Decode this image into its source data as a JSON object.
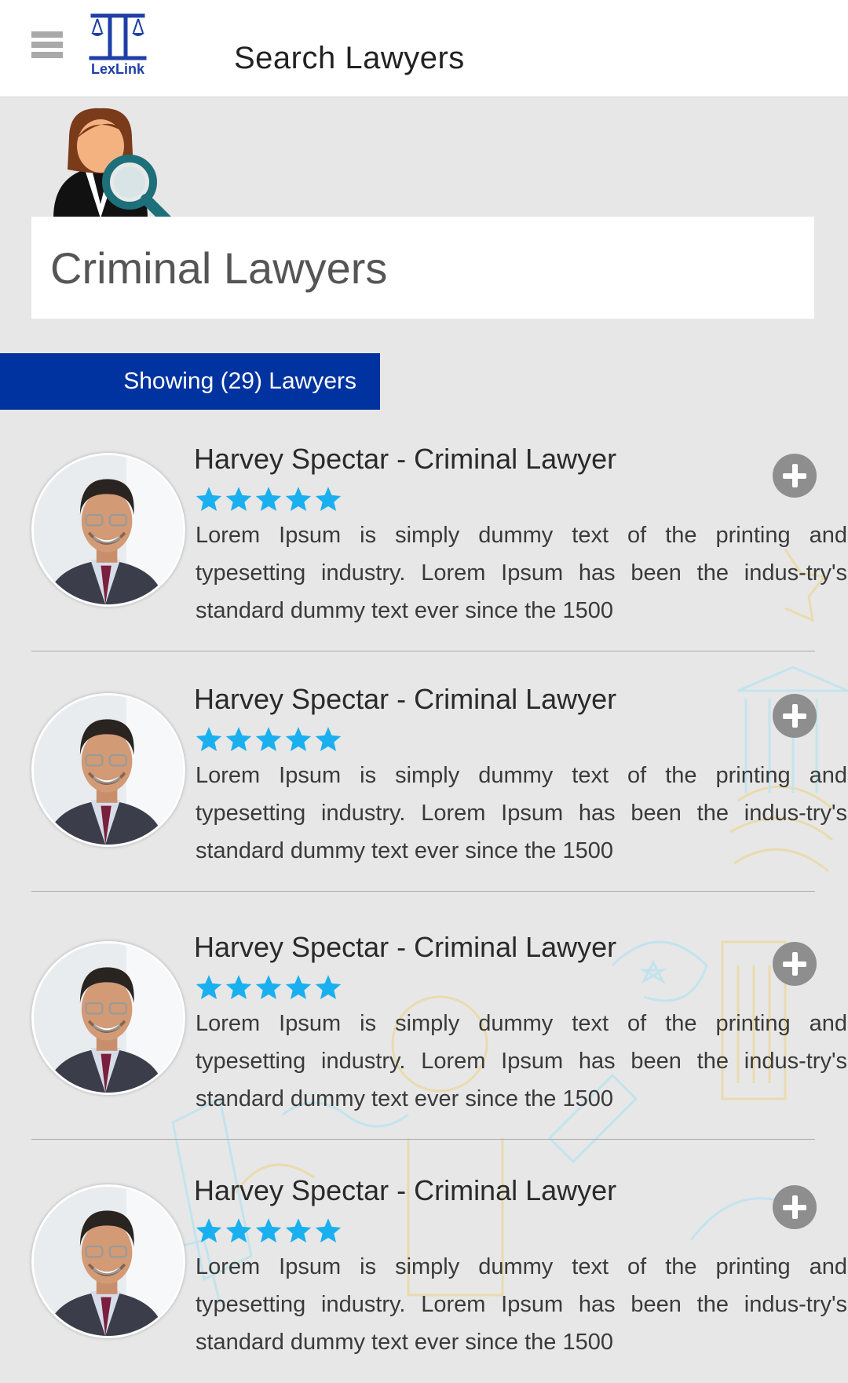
{
  "app": {
    "logo_text": "LexLink",
    "page_title": "Search Lawyers",
    "accent_color": "#0033a0",
    "star_color": "#1ab0f0"
  },
  "search": {
    "value": "Criminal Lawyers"
  },
  "results": {
    "count_label": "Showing (29) Lawyers"
  },
  "lawyers": [
    {
      "name": "Harvey Spectar - Criminal Lawyer",
      "rating": 5,
      "description": "Lorem Ipsum is simply dummy text of the printing and typesetting industry. Lorem Ipsum has been the indus-try's standard dummy text ever since the 1500"
    },
    {
      "name": "Harvey Spectar - Criminal Lawyer",
      "rating": 5,
      "description": "Lorem Ipsum is simply dummy text of the printing and typesetting industry. Lorem Ipsum has been the indus-try's standard dummy text ever since the 1500"
    },
    {
      "name": "Harvey Spectar - Criminal Lawyer",
      "rating": 5,
      "description": "Lorem Ipsum is simply dummy text of the printing and typesetting industry. Lorem Ipsum has been the indus-try's standard dummy text ever since the 1500"
    },
    {
      "name": "Harvey Spectar - Criminal Lawyer",
      "rating": 5,
      "description": "Lorem Ipsum is simply dummy text of the printing and typesetting industry. Lorem Ipsum has been the indus-try's standard dummy text ever since the 1500"
    }
  ]
}
